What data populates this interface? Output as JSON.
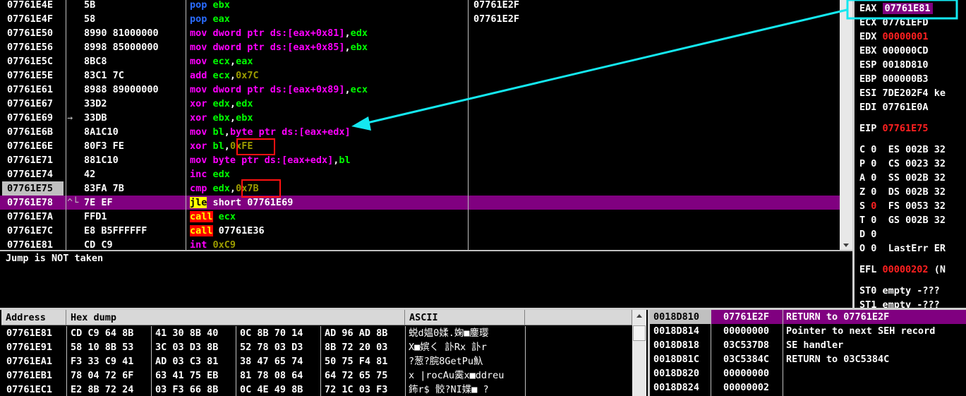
{
  "disasm": {
    "rows": [
      {
        "addr": "07761E4E",
        "jmp": "",
        "bytes": "5B",
        "mn": "pop",
        "mc": "blue",
        "ops": [
          {
            "t": "ebx",
            "c": "green"
          }
        ]
      },
      {
        "addr": "07761E4F",
        "jmp": "",
        "bytes": "58",
        "mn": "pop",
        "mc": "blue",
        "ops": [
          {
            "t": "eax",
            "c": "green"
          }
        ]
      },
      {
        "addr": "07761E50",
        "jmp": "",
        "bytes": "8990 81000000",
        "mn": "mov",
        "mc": "mag",
        "ops": [
          {
            "t": "dword ptr ds:[eax+0x81]",
            "c": "mag"
          },
          {
            "t": ",",
            "c": "white"
          },
          {
            "t": "edx",
            "c": "green"
          }
        ]
      },
      {
        "addr": "07761E56",
        "jmp": "",
        "bytes": "8998 85000000",
        "mn": "mov",
        "mc": "mag",
        "ops": [
          {
            "t": "dword ptr ds:[eax+0x85]",
            "c": "mag"
          },
          {
            "t": ",",
            "c": "white"
          },
          {
            "t": "ebx",
            "c": "green"
          }
        ]
      },
      {
        "addr": "07761E5C",
        "jmp": "",
        "bytes": "8BC8",
        "mn": "mov",
        "mc": "mag",
        "ops": [
          {
            "t": "ecx",
            "c": "green"
          },
          {
            "t": ",",
            "c": "white"
          },
          {
            "t": "eax",
            "c": "green"
          }
        ]
      },
      {
        "addr": "07761E5E",
        "jmp": "",
        "bytes": "83C1 7C",
        "mn": "add",
        "mc": "mag",
        "ops": [
          {
            "t": "ecx",
            "c": "green"
          },
          {
            "t": ",",
            "c": "white"
          },
          {
            "t": "0x7C",
            "c": "olive"
          }
        ]
      },
      {
        "addr": "07761E61",
        "jmp": "",
        "bytes": "8988 89000000",
        "mn": "mov",
        "mc": "mag",
        "ops": [
          {
            "t": "dword ptr ds:[eax+0x89]",
            "c": "mag"
          },
          {
            "t": ",",
            "c": "white"
          },
          {
            "t": "ecx",
            "c": "green"
          }
        ]
      },
      {
        "addr": "07761E67",
        "jmp": "",
        "bytes": "33D2",
        "mn": "xor",
        "mc": "mag",
        "ops": [
          {
            "t": "edx",
            "c": "green"
          },
          {
            "t": ",",
            "c": "white"
          },
          {
            "t": "edx",
            "c": "green"
          }
        ]
      },
      {
        "addr": "07761E69",
        "jmp": "→",
        "bytes": "33DB",
        "mn": "xor",
        "mc": "mag",
        "ops": [
          {
            "t": "ebx",
            "c": "green"
          },
          {
            "t": ",",
            "c": "white"
          },
          {
            "t": "ebx",
            "c": "green"
          }
        ]
      },
      {
        "addr": "07761E6B",
        "jmp": "",
        "bytes": "8A1C10",
        "mn": "mov",
        "mc": "mag",
        "ops": [
          {
            "t": "bl",
            "c": "green"
          },
          {
            "t": ",",
            "c": "white"
          },
          {
            "t": "byte ptr ds:[eax+edx]",
            "c": "mag"
          }
        ]
      },
      {
        "addr": "07761E6E",
        "jmp": "",
        "bytes": "80F3 FE",
        "mn": "xor",
        "mc": "mag",
        "ops": [
          {
            "t": "bl",
            "c": "green"
          },
          {
            "t": ",",
            "c": "white"
          },
          {
            "t": "0xFE",
            "c": "olive"
          }
        ]
      },
      {
        "addr": "07761E71",
        "jmp": "",
        "bytes": "881C10",
        "mn": "mov",
        "mc": "mag",
        "ops": [
          {
            "t": "byte ptr ds:[eax+edx]",
            "c": "mag"
          },
          {
            "t": ",",
            "c": "white"
          },
          {
            "t": "bl",
            "c": "green"
          }
        ]
      },
      {
        "addr": "07761E74",
        "jmp": "",
        "bytes": "42",
        "mn": "inc",
        "mc": "mag",
        "ops": [
          {
            "t": "edx",
            "c": "green"
          }
        ]
      },
      {
        "addr": "07761E75",
        "jmp": "",
        "bytes": "83FA 7B",
        "mn": "cmp",
        "mc": "mag",
        "ops": [
          {
            "t": "edx",
            "c": "green"
          },
          {
            "t": ",",
            "c": "white"
          },
          {
            "t": "0x7B",
            "c": "olive"
          }
        ]
      },
      {
        "addr": "07761E78",
        "jmp": "^└",
        "bytes": "7E EF",
        "mn": "jle",
        "mc": "jle",
        "ops": [
          {
            "t": "short 07761E69",
            "c": "white"
          }
        ]
      },
      {
        "addr": "07761E7A",
        "jmp": "",
        "bytes": "FFD1",
        "mn": "call",
        "mc": "call",
        "ops": [
          {
            "t": "ecx",
            "c": "green"
          }
        ]
      },
      {
        "addr": "07761E7C",
        "jmp": "",
        "bytes": "E8 B5FFFFFF",
        "mn": "call",
        "mc": "call",
        "ops": [
          {
            "t": "07761E36",
            "c": "white"
          }
        ]
      },
      {
        "addr": "07761E81",
        "jmp": "",
        "bytes": "CD C9",
        "mn": "int",
        "mc": "mag",
        "ops": [
          {
            "t": "0xC9",
            "c": "olive"
          }
        ]
      }
    ],
    "comments": [
      "07761E2F",
      "07761E2F"
    ],
    "info_text": "Jump is NOT taken"
  },
  "registers": {
    "eax": {
      "name": "EAX",
      "value": "07761E81"
    },
    "ecx": {
      "name": "ECX",
      "value": "07761EFD"
    },
    "edx": {
      "name": "EDX",
      "value": "00000001"
    },
    "ebx": {
      "name": "EBX",
      "value": "000000CD"
    },
    "esp": {
      "name": "ESP",
      "value": "0018D810"
    },
    "ebp": {
      "name": "EBP",
      "value": "000000B3"
    },
    "esi": {
      "name": "ESI",
      "value": "7DE202F4",
      "extra": "ke"
    },
    "edi": {
      "name": "EDI",
      "value": "07761E0A"
    },
    "eip": {
      "name": "EIP",
      "value": "07761E75"
    },
    "flags": [
      {
        "f": "C",
        "v": "0",
        "seg": "ES",
        "sel": "002B",
        "bits": "32",
        "red": false
      },
      {
        "f": "P",
        "v": "0",
        "seg": "CS",
        "sel": "0023",
        "bits": "32",
        "red": false
      },
      {
        "f": "A",
        "v": "0",
        "seg": "SS",
        "sel": "002B",
        "bits": "32",
        "red": false
      },
      {
        "f": "Z",
        "v": "0",
        "seg": "DS",
        "sel": "002B",
        "bits": "32",
        "red": false
      },
      {
        "f": "S",
        "v": "0",
        "seg": "FS",
        "sel": "0053",
        "bits": "32",
        "red": true
      },
      {
        "f": "T",
        "v": "0",
        "seg": "GS",
        "sel": "002B",
        "bits": "32",
        "red": false
      },
      {
        "f": "D",
        "v": "0",
        "seg": "",
        "sel": "",
        "bits": "",
        "red": false
      }
    ],
    "lasterr": {
      "f": "O",
      "v": "0",
      "label": "LastErr",
      "value": "ER"
    },
    "efl": {
      "label": "EFL",
      "value": "00000202",
      "suffix": "(N"
    },
    "st0": "ST0 empty -???",
    "st1": "ST1 empty -???"
  },
  "dump": {
    "headers": {
      "address": "Address",
      "hex": "Hex dump",
      "ascii": "ASCII"
    },
    "rows": [
      {
        "addr": "07761E81",
        "g": [
          "CD C9 64 8B",
          "41 30 8B 40",
          "0C 8B 70 14",
          "AD 96 AD 8B"
        ],
        "ascii": "蜕d媪0媃.婅■鏖璎"
      },
      {
        "addr": "07761E91",
        "g": [
          "58 10 8B 53",
          "3C 03 D3 8B",
          "52 78 03 D3",
          "8B 72 20 03"
        ],
        "ascii": "X■嫔く 訃Rx 訃r"
      },
      {
        "addr": "07761EA1",
        "g": [
          "F3 33 C9 41",
          "AD 03 C3 81",
          "38 47 65 74",
          "50 75 F4 81"
        ],
        "ascii": "?葱?脘8GetPu魞"
      },
      {
        "addr": "07761EB1",
        "g": [
          "78 04 72 6F",
          "63 41 75 EB",
          "81 78 08 64",
          "64 72 65 75"
        ],
        "ascii": "x |rocAu霙x■ddreu"
      },
      {
        "addr": "07761EC1",
        "g": [
          "E2 8B 72 24",
          "03 F3 66 8B",
          "0C 4E 49 8B",
          "72 1C 03 F3"
        ],
        "ascii": "鈽r$ 骹?NI媟■ ?"
      }
    ]
  },
  "stack": {
    "rows": [
      {
        "addr": "0018D810",
        "val": "07761E2F",
        "cmt": "RETURN to 07761E2F",
        "sel": true
      },
      {
        "addr": "0018D814",
        "val": "00000000",
        "cmt": "Pointer to next SEH record",
        "sel": false
      },
      {
        "addr": "0018D818",
        "val": "03C537D8",
        "cmt": "SE handler",
        "sel": false
      },
      {
        "addr": "0018D81C",
        "val": "03C5384C",
        "cmt": "RETURN to 03C5384C",
        "sel": false
      },
      {
        "addr": "0018D820",
        "val": "00000000",
        "cmt": "",
        "sel": false
      },
      {
        "addr": "0018D824",
        "val": "00000002",
        "cmt": "",
        "sel": false
      }
    ]
  },
  "colors": {
    "selected_row": "#800080",
    "eip_highlight": "#c0c0c0",
    "arrow": "#14e8f0",
    "annotation_box": "#ff1010"
  }
}
